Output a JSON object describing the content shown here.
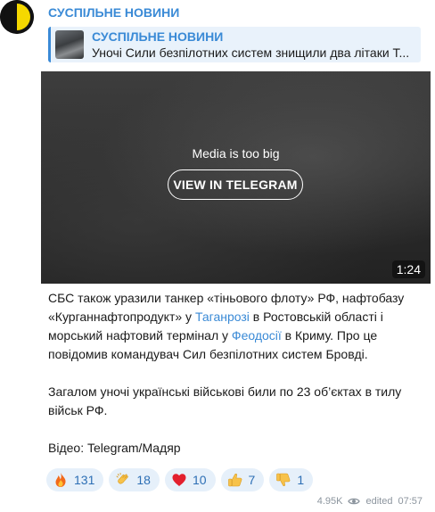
{
  "post": {
    "channel_name": "СУСПІЛЬНЕ НОВИНИ",
    "reply": {
      "title": "СУСПІЛЬНЕ НОВИНИ",
      "text": "Уночі Сили безпілотних систем знищили два літаки Т..."
    },
    "media": {
      "message": "Media is too big",
      "button_label": "VIEW IN TELEGRAM",
      "duration": "1:24"
    },
    "text": {
      "p1_a": "СБС також уразили танкер «тіньового флоту» РФ, нафтобазу «Курганнафтопродукт» у ",
      "link_taganrog": "Таганрозі",
      "p1_b": " в Ростовській області і морський нафтовий термінал у ",
      "link_feodosia": "Феодосії",
      "p1_c": " в Криму. Про це повідомив командувач Сил безпілотних систем Бровді.",
      "p2": "Загалом уночі українські військові били по 23 об’єктах в тилу військ РФ.",
      "p3": "Відео: Telegram/Мадяр"
    },
    "reactions": [
      {
        "icon": "fire-icon",
        "count": "131"
      },
      {
        "icon": "clapping-hands-icon",
        "count": "18"
      },
      {
        "icon": "red-heart-icon",
        "count": "10"
      },
      {
        "icon": "thumbs-up-icon",
        "count": "7"
      },
      {
        "icon": "thumbs-down-icon",
        "count": "1"
      }
    ],
    "meta": {
      "views": "4.95K",
      "edited_label": "edited",
      "time": "07:57"
    }
  },
  "colors": {
    "accent": "#3a8ad6",
    "reaction_bg": "#e6f0fa",
    "reply_bg": "#e9f2fb",
    "meta_text": "#8c959e"
  }
}
